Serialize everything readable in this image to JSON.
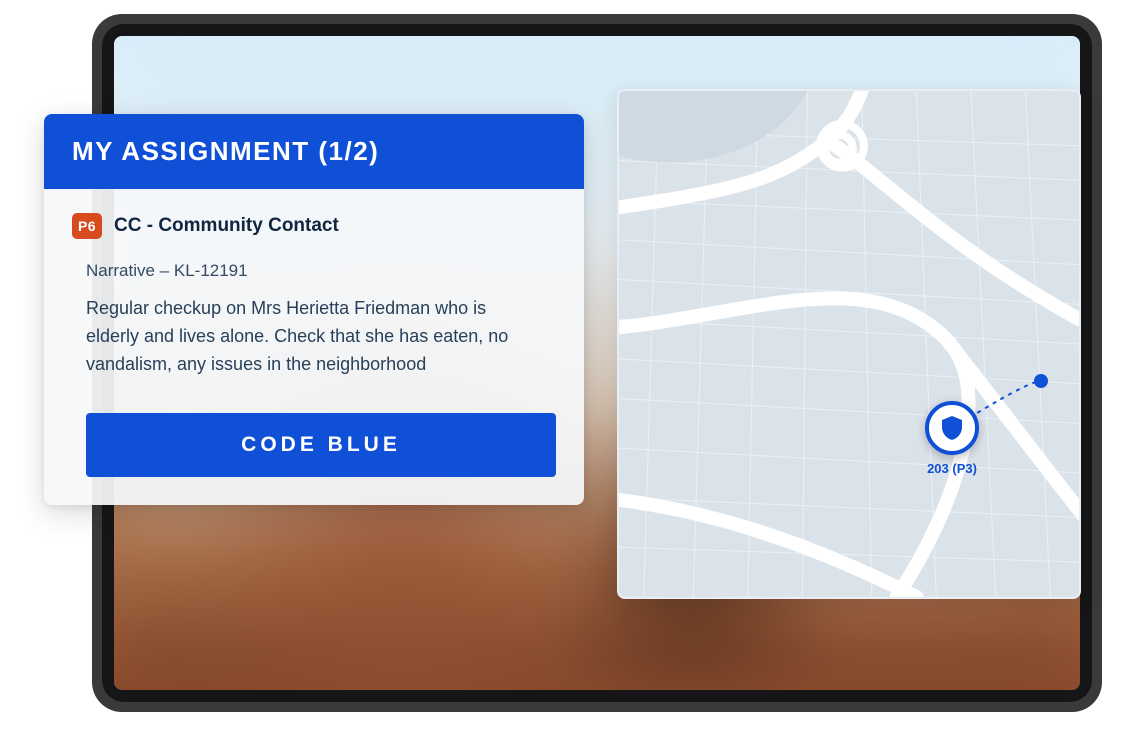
{
  "assignment": {
    "header": "MY ASSIGNMENT (1/2)",
    "priority_badge": "P6",
    "incident_type": "CC - Community Contact",
    "narrative_label": "Narrative – KL-12191",
    "narrative_text": "Regular checkup on Mrs Herietta Friedman who is elderly and lives alone. Check that she has eaten, no vandalism, any issues in the neighborhood",
    "action_button": "CODE BLUE"
  },
  "map": {
    "unit_label": "203 (P3)",
    "colors": {
      "background": "#dfe6ec",
      "roads": "#ffffff",
      "accent": "#1050d6"
    }
  },
  "colors": {
    "primary": "#1050d6",
    "priority_badge": "#d84a1f",
    "text_dark": "#10253e"
  }
}
